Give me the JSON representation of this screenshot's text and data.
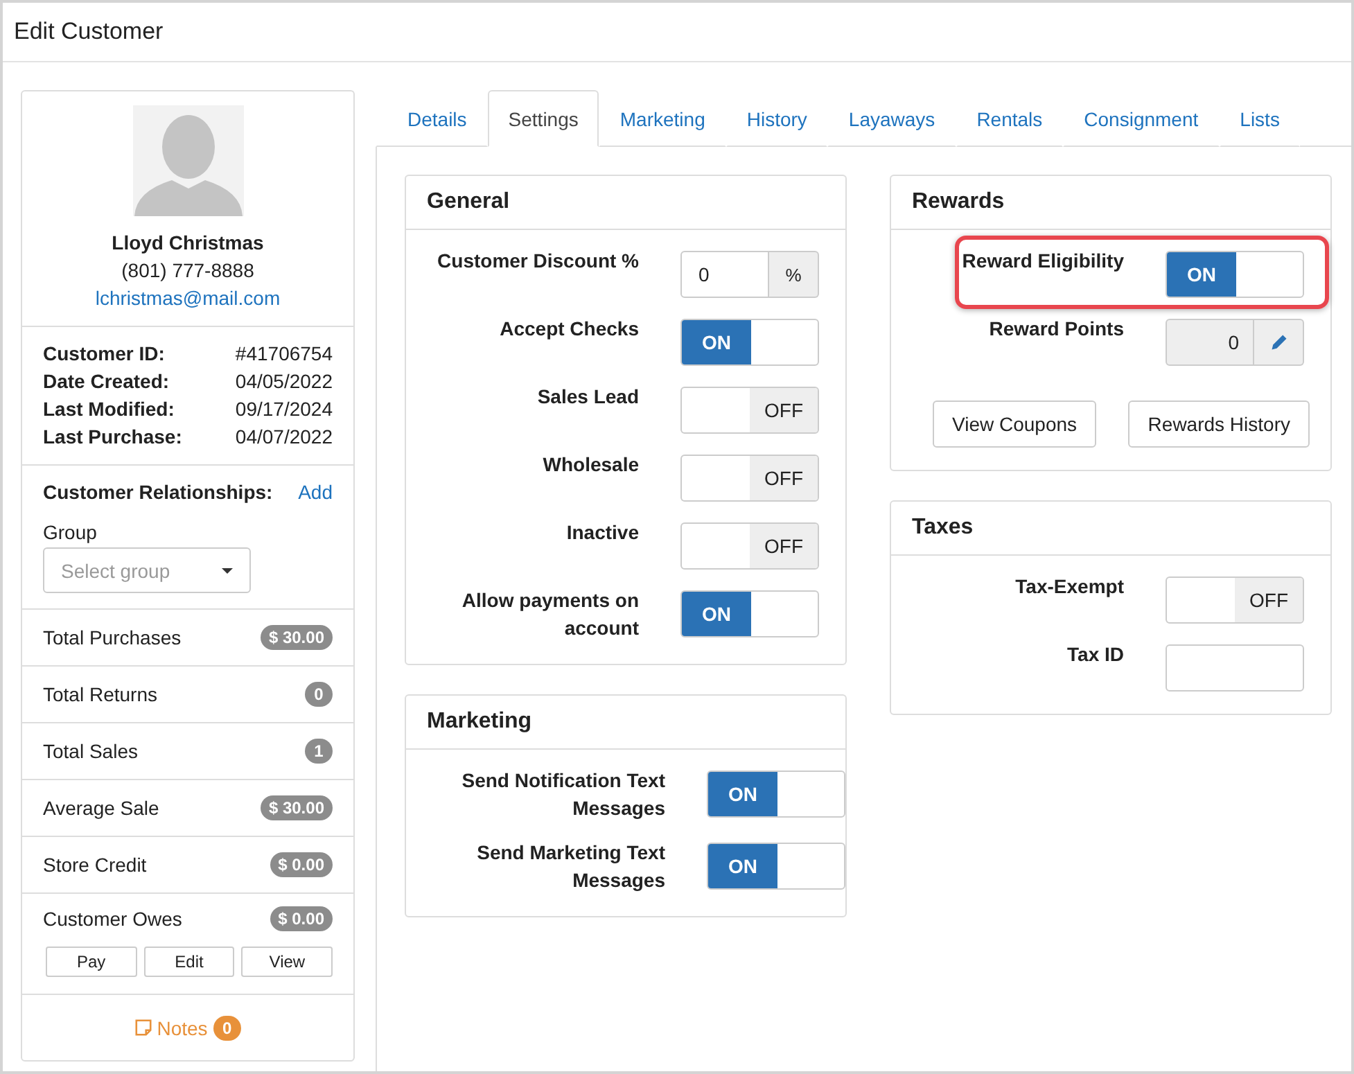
{
  "window": {
    "title": "Edit Customer"
  },
  "customer": {
    "name": "Lloyd Christmas",
    "phone": "(801) 777-8888",
    "email": "lchristmas@mail.com"
  },
  "details": [
    {
      "label": "Customer ID:",
      "value": "#41706754"
    },
    {
      "label": "Date Created:",
      "value": "04/05/2022"
    },
    {
      "label": "Last Modified:",
      "value": "09/17/2024"
    },
    {
      "label": "Last Purchase:",
      "value": "04/07/2022"
    }
  ],
  "relationships": {
    "label": "Customer Relationships:",
    "action": "Add",
    "group_label": "Group",
    "group_placeholder": "Select group"
  },
  "stats": [
    {
      "label": "Total Purchases",
      "value": "$ 30.00"
    },
    {
      "label": "Total Returns",
      "value": "0"
    },
    {
      "label": "Total Sales",
      "value": "1"
    },
    {
      "label": "Average Sale",
      "value": "$ 30.00"
    },
    {
      "label": "Store Credit",
      "value": "$ 0.00"
    },
    {
      "label": "Customer Owes",
      "value": "$ 0.00",
      "buttons": [
        "Pay",
        "Edit",
        "View"
      ]
    }
  ],
  "notes": {
    "label": "Notes",
    "count": "0"
  },
  "tabs": [
    {
      "label": "Details",
      "selected": false
    },
    {
      "label": "Settings",
      "selected": true
    },
    {
      "label": "Marketing",
      "selected": false
    },
    {
      "label": "History",
      "selected": false
    },
    {
      "label": "Layaways",
      "selected": false
    },
    {
      "label": "Rentals",
      "selected": false
    },
    {
      "label": "Consignment",
      "selected": false
    },
    {
      "label": "Lists",
      "selected": false
    }
  ],
  "settings": {
    "left": [
      {
        "title": "General",
        "rows": [
          {
            "kind": "percent",
            "label": "Customer Discount %",
            "value": "0",
            "unit": "%"
          },
          {
            "kind": "toggle",
            "label": "Accept Checks",
            "on": true,
            "state_label": "ON"
          },
          {
            "kind": "toggle",
            "label": "Sales Lead",
            "on": false,
            "state_label": "OFF"
          },
          {
            "kind": "toggle",
            "label": "Wholesale",
            "on": false,
            "state_label": "OFF"
          },
          {
            "kind": "toggle",
            "label": "Inactive",
            "on": false,
            "state_label": "OFF"
          },
          {
            "kind": "toggle",
            "label": "Allow payments on account",
            "on": true,
            "state_label": "ON"
          }
        ]
      },
      {
        "title": "Marketing",
        "rows": [
          {
            "kind": "toggle",
            "label": "Send Notification Text Messages",
            "on": true,
            "state_label": "ON"
          },
          {
            "kind": "toggle",
            "label": "Send Marketing Text Messages",
            "on": true,
            "state_label": "ON"
          }
        ]
      }
    ],
    "right": [
      {
        "title": "Rewards",
        "rows": [
          {
            "kind": "toggle",
            "label": "Reward Eligibility",
            "on": true,
            "state_label": "ON",
            "highlighted": true
          },
          {
            "kind": "points",
            "label": "Reward Points",
            "value": "0"
          }
        ],
        "buttons": [
          "View Coupons",
          "Rewards History"
        ]
      },
      {
        "title": "Taxes",
        "rows": [
          {
            "kind": "toggle",
            "label": "Tax-Exempt",
            "on": false,
            "state_label": "OFF"
          },
          {
            "kind": "text",
            "label": "Tax ID"
          }
        ]
      }
    ]
  }
}
